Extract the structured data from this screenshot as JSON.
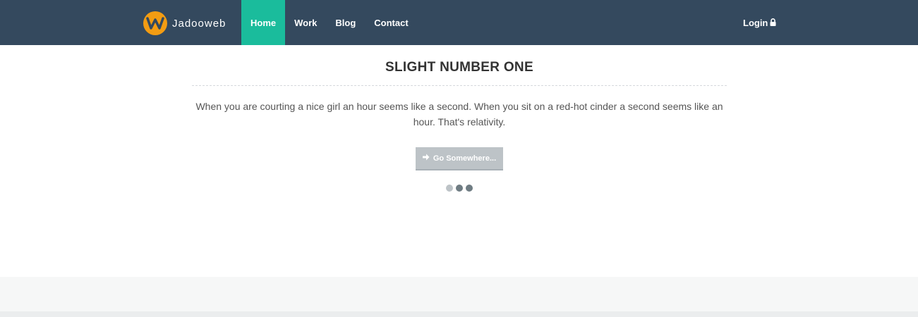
{
  "brand": {
    "name": "Jadooweb",
    "logo_letter": "W",
    "logo_color": "#f39c12"
  },
  "nav": {
    "items": [
      {
        "label": "Home",
        "active": true
      },
      {
        "label": "Work",
        "active": false
      },
      {
        "label": "Blog",
        "active": false
      },
      {
        "label": "Contact",
        "active": false
      }
    ],
    "login_label": "Login",
    "login_icon": "lock-icon"
  },
  "slide": {
    "title": "SLIGHT NUMBER ONE",
    "text": "When you are courting a nice girl an hour seems like a second. When you sit on a red-hot cinder a second seems like an hour. That's relativity.",
    "button_label": "Go Somewhere...",
    "button_icon": "arrow-right-icon"
  },
  "carousel": {
    "dots": 3,
    "active_index": 0
  },
  "colors": {
    "navbar": "#34495e",
    "active_nav": "#1abc9c",
    "button": "#bdc3c7",
    "dot_active": "#bdc3c7",
    "dot": "#6f7c83"
  }
}
